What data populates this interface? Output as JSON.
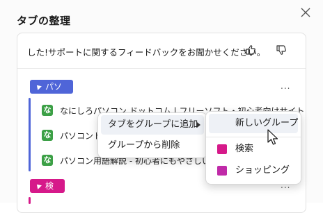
{
  "panel": {
    "title": "タブの整理",
    "close_icon": "close-icon"
  },
  "feedback": {
    "text": "した!サポートに関するフィードバックをお聞かせください。",
    "like_icon": "thumbs-up-icon",
    "dislike_icon": "thumbs-down-icon"
  },
  "groups": [
    {
      "label": "パソコン",
      "color": "#4f65d8",
      "more": "...",
      "tabs": [
        {
          "title": "なにしろパソコン.ドットコム | フリーソフト・初心者向けサイト",
          "icon_label": "な"
        },
        {
          "title": "パソコントラブル",
          "icon_label": "な"
        },
        {
          "title": "パソコン用語解説 - 初心者にもやさしいIT用語辞典",
          "icon_label": "な"
        }
      ]
    },
    {
      "label": "検索",
      "color": "#d6198a",
      "more": "..."
    }
  ],
  "context_menu": {
    "items": [
      {
        "label": "タブをグループに追加",
        "has_submenu": true
      },
      {
        "label": "グループから削除"
      }
    ]
  },
  "submenu": {
    "new_group": "新しいグループ",
    "groups": [
      {
        "label": "検索",
        "color": "#d6198a"
      },
      {
        "label": "ショッピング",
        "color": "#c02aa8"
      }
    ]
  }
}
